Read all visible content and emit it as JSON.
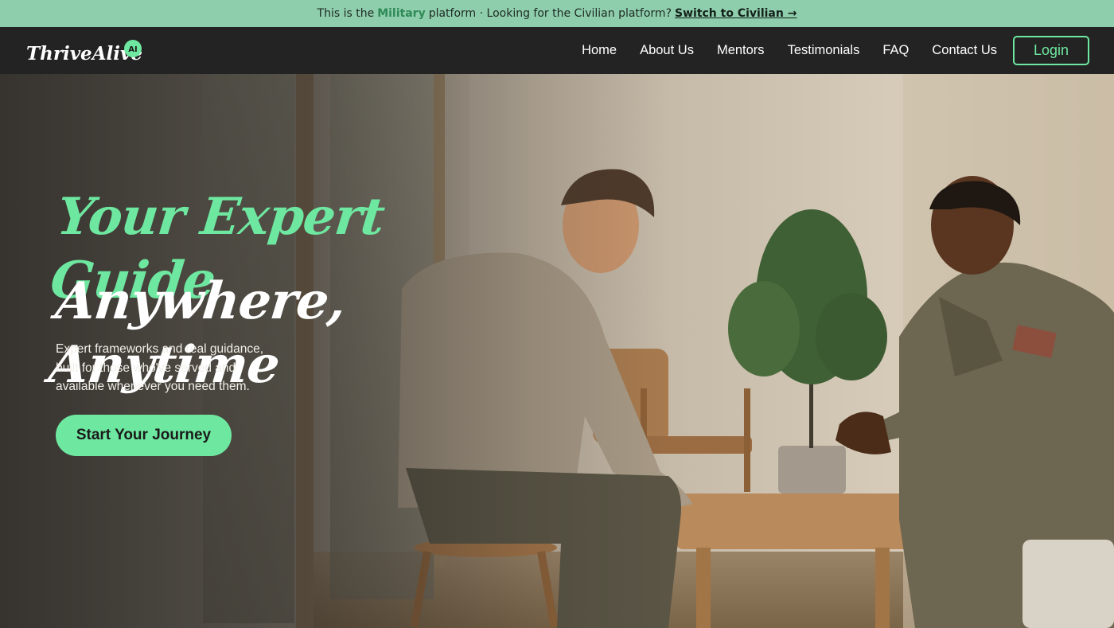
{
  "banner": {
    "prefix": "This is the",
    "platform": "Military",
    "middle": "platform · Looking for the Civilian platform?",
    "switch_label": "Switch to Civilian →"
  },
  "nav": {
    "logo_text": "ThriveAlive",
    "logo_badge": "AI",
    "links": [
      "Home",
      "About Us",
      "Mentors",
      "Testimonials",
      "FAQ",
      "Contact Us"
    ],
    "login_label": "Login"
  },
  "hero": {
    "headline_1": "Your Expert Guide",
    "headline_2": "Anywhere, Anytime",
    "subtext_lines": [
      "Expert frameworks and real guidance,",
      "built for those who've served and",
      "available whenever you need them."
    ],
    "cta_label": "Start Your Journey"
  },
  "colors": {
    "banner_bg": "#8fceac",
    "nav_bg": "#232323",
    "accent": "#6ee8a0"
  }
}
